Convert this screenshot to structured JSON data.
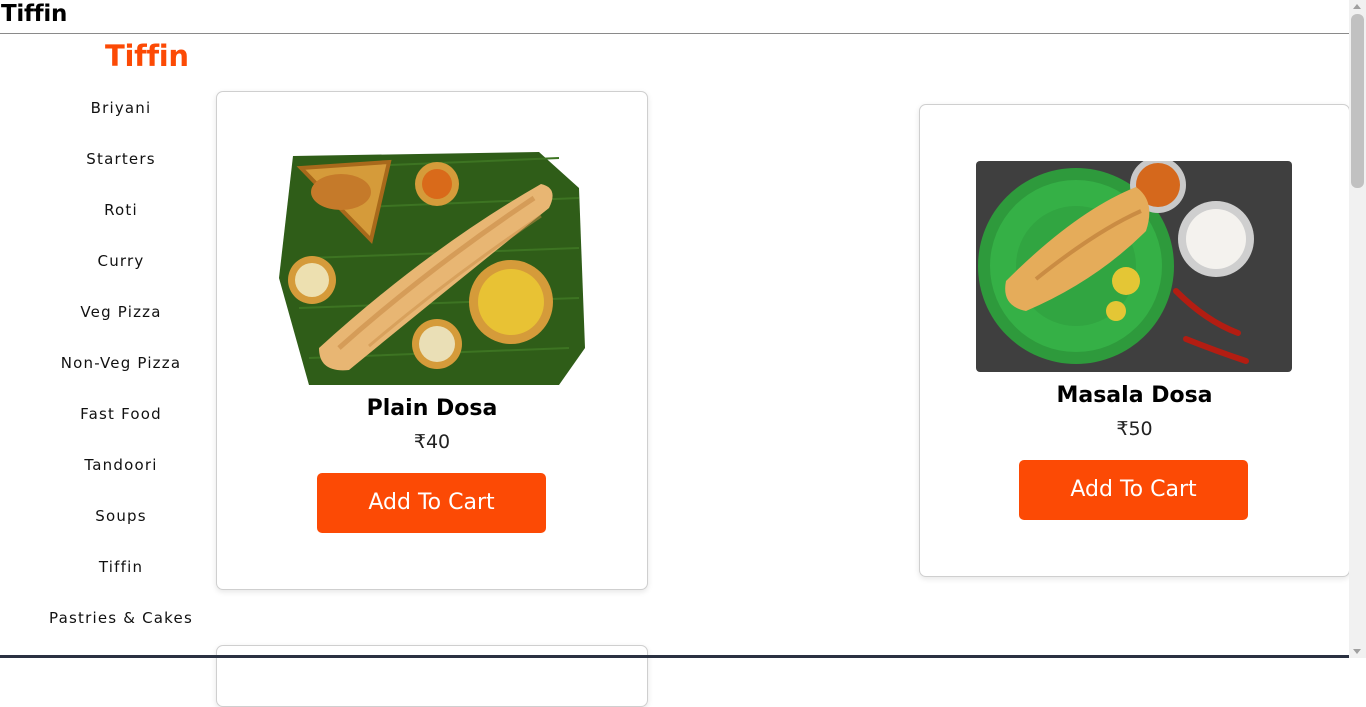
{
  "topbar": {
    "title": "Tiffin"
  },
  "brand": {
    "name": "Tiffin",
    "color": "#fc4a05"
  },
  "sidebar": {
    "items": [
      {
        "label": "Briyani"
      },
      {
        "label": "Starters"
      },
      {
        "label": "Roti"
      },
      {
        "label": "Curry"
      },
      {
        "label": "Veg Pizza"
      },
      {
        "label": "Non-Veg Pizza"
      },
      {
        "label": "Fast Food"
      },
      {
        "label": "Tandoori"
      },
      {
        "label": "Soups"
      },
      {
        "label": "Tiffin"
      },
      {
        "label": "Pastries & Cakes"
      }
    ]
  },
  "products": [
    {
      "name": "Plain Dosa",
      "price": "₹40",
      "button": "Add To Cart",
      "image_icon": "plain-dosa-image"
    },
    {
      "name": "Masala Dosa",
      "price": "₹50",
      "button": "Add To Cart",
      "image_icon": "masala-dosa-image"
    }
  ],
  "colors": {
    "accent": "#fc4a05",
    "button_text": "#ffffff"
  }
}
